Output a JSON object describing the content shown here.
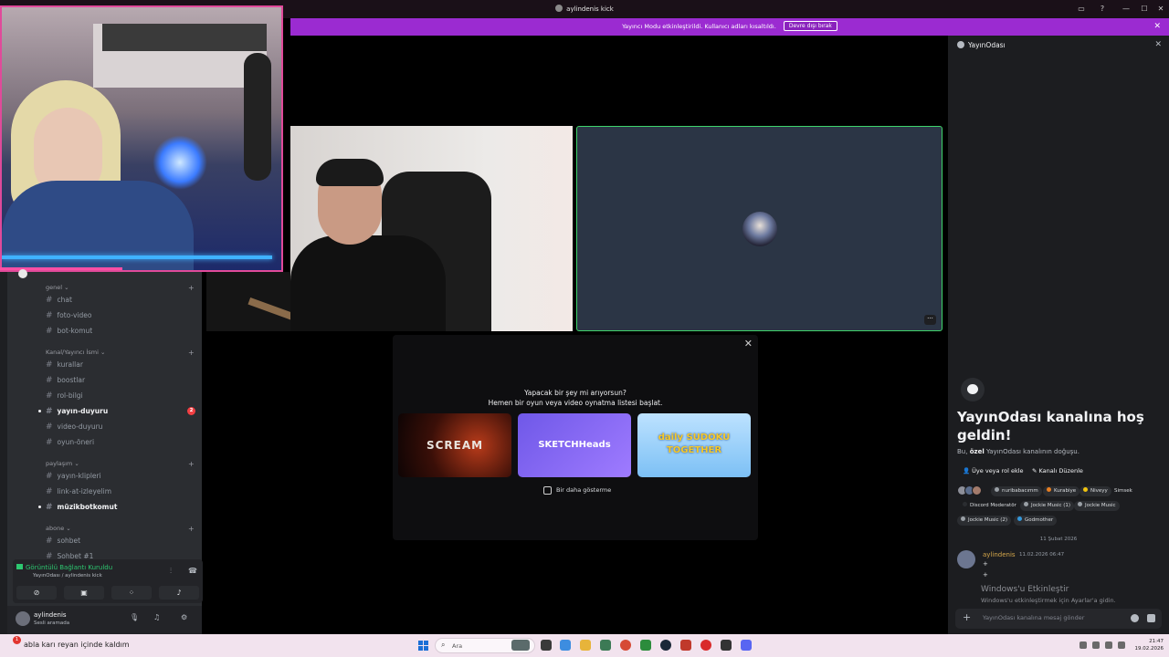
{
  "window": {
    "title": "aylindenis kick",
    "minimize_glyph": "—",
    "maximize_glyph": "☐",
    "close_glyph": "✕"
  },
  "banner": {
    "text": "Yayıncı Modu etkinleştirildi. Kullanıcı adları kısaltıldı.",
    "button": "Devre dışı bırak",
    "close_glyph": "✕"
  },
  "sidebar": {
    "categories": [
      {
        "label": "genel ⌄",
        "plus": "+"
      },
      {
        "label": "Kanal/Yayıncı İsmi ⌄",
        "plus": "+"
      },
      {
        "label": "paylaşım ⌄",
        "plus": "+"
      },
      {
        "label": "abone ⌄",
        "plus": "+"
      }
    ],
    "channels": [
      {
        "label": "chat"
      },
      {
        "label": "foto-video"
      },
      {
        "label": "bot-komut"
      },
      {
        "label": "kurallar"
      },
      {
        "label": "boostlar"
      },
      {
        "label": "rol-bilgi"
      },
      {
        "label": "yayın-duyuru",
        "badge": "2"
      },
      {
        "label": "video-duyuru"
      },
      {
        "label": "oyun-öneri"
      },
      {
        "label": "yayın-klipleri"
      },
      {
        "label": "link-at-izleyelim"
      },
      {
        "label": "müzikbotkomut"
      },
      {
        "label": "sohbet"
      },
      {
        "label": "Sohbet #1"
      }
    ],
    "hash": "#",
    "voice": {
      "title": "Görüntülü Bağlantı Kuruldu",
      "subtitle": "YayınOdası / aylindenis kick"
    },
    "user": {
      "name": "aylindenis",
      "status": "Sesli aramada"
    }
  },
  "activity": {
    "close_glyph": "✕",
    "question": "Yapacak bir şey mi arıyorsun?",
    "hint": "Hemen bir oyun veya video oynatma listesi başlat.",
    "games": [
      {
        "name": "SCREAM",
        "color": "#b83b1a"
      },
      {
        "name": "SKETCHHeads",
        "color": "#6f58e8"
      },
      {
        "name": "daily SUDOKU TOGETHER",
        "color": "#7cc0f5"
      }
    ],
    "dont_show": "Bir daha gösterme"
  },
  "tile": {
    "more": "···"
  },
  "chat": {
    "header": "YayınOdası",
    "close_glyph": "✕",
    "welcome_title": "YayınOdası kanalına hoş geldin!",
    "welcome_prefix": "Bu, ",
    "welcome_bold": "özel",
    "welcome_suffix": " YayınOdası kanalının doğuşu.",
    "add_member": "Üye veya rol ekle",
    "edit_channel": "Kanalı Düzenle",
    "roles": [
      {
        "label": "nuribabacımm",
        "color": "#9aa0a6"
      },
      {
        "label": "Kurabiye",
        "color": "#e67e22"
      },
      {
        "label": "Niveyy",
        "color": "#f1c40f"
      },
      {
        "label": "Simsek",
        "color": "#9aa0a6"
      },
      {
        "label": "Discord Moderatör",
        "color": "#2b2d31"
      },
      {
        "label": "Jockie Music (1)",
        "color": "#9aa0a6"
      },
      {
        "label": "Jockie Music",
        "color": "#9aa0a6"
      },
      {
        "label": "Jockie Music (2)",
        "color": "#9aa0a6"
      },
      {
        "label": "Godmother",
        "color": "#3498db"
      }
    ],
    "date_separator": "11 Şubat 2026",
    "message": {
      "author": "aylindenis",
      "time": "11.02.2026 06:47",
      "lines": [
        "+",
        "+"
      ]
    },
    "watermark_title": "Windows'u Etkinleştir",
    "watermark_sub": "Windows'u etkinleştirmek için Ayarlar'a gidin.",
    "input_placeholder": "YayınOdası kanalına mesaj gönder",
    "input_plus": "+"
  },
  "taskbar": {
    "notification_count": "1",
    "ticker": "abla karı reyan içinde kaldım",
    "search_placeholder": "Ara",
    "time": "21:47",
    "date": "19.02.2026"
  },
  "colors": {
    "banner": "#9b2bd1",
    "accent_online": "#2dc770",
    "speaking_border": "#3fd46b",
    "webcam_border": "#e04a9a"
  }
}
